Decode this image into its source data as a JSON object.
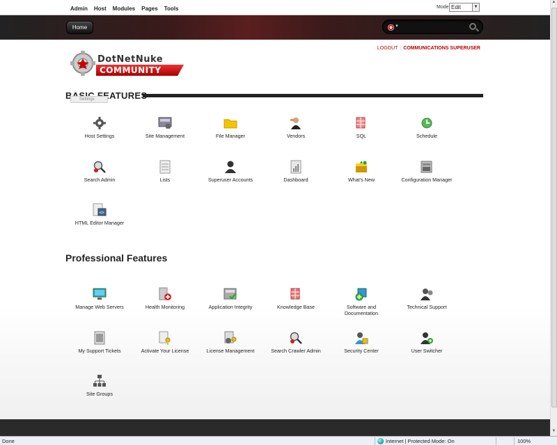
{
  "control_panel": {
    "menu": [
      "Admin",
      "Host",
      "Modules",
      "Pages",
      "Tools"
    ],
    "mode_label": "Mode",
    "mode_value": "Edit"
  },
  "header": {
    "home_label": "Home",
    "search_placeholder": ""
  },
  "user": {
    "logout": "LOGOUT",
    "username": "COMMUNICATIONS SUPERUSER"
  },
  "logo": {
    "top_text": "DotNetNuke",
    "bottom_text": "COMMUNITY"
  },
  "basic": {
    "title": "BASIC FEATURES",
    "tooltip": "Settings",
    "items": [
      {
        "label": "Host Settings",
        "icon": "gear-icon"
      },
      {
        "label": "Site Management",
        "icon": "site-icon"
      },
      {
        "label": "File Manager",
        "icon": "folder-icon"
      },
      {
        "label": "Vendors",
        "icon": "vendor-icon"
      },
      {
        "label": "SQL",
        "icon": "sql-icon"
      },
      {
        "label": "Schedule",
        "icon": "schedule-icon"
      },
      {
        "label": "Search Admin",
        "icon": "search-admin-icon"
      },
      {
        "label": "Lists",
        "icon": "lists-icon"
      },
      {
        "label": "Superuser Accounts",
        "icon": "user-icon"
      },
      {
        "label": "Dashboard",
        "icon": "dashboard-icon"
      },
      {
        "label": "What's New",
        "icon": "whats-new-icon"
      },
      {
        "label": "Configuration Manager",
        "icon": "config-icon"
      },
      {
        "label": "HTML Editor Manager",
        "icon": "html-editor-icon"
      }
    ]
  },
  "professional": {
    "title": "Professional Features",
    "items": [
      {
        "label": "Manage Web Servers",
        "icon": "server-icon"
      },
      {
        "label": "Health Monitoring",
        "icon": "health-icon"
      },
      {
        "label": "Application Integrity",
        "icon": "integrity-icon"
      },
      {
        "label": "Knowledge Base",
        "icon": "knowledge-icon"
      },
      {
        "label": "Software and Documentation",
        "icon": "software-icon"
      },
      {
        "label": "Technical Support",
        "icon": "support-icon"
      },
      {
        "label": "My Support Tickets",
        "icon": "tickets-icon"
      },
      {
        "label": "Activate Your License",
        "icon": "license-icon"
      },
      {
        "label": "License Management",
        "icon": "license-mgmt-icon"
      },
      {
        "label": "Search Crawler Admin",
        "icon": "crawler-icon"
      },
      {
        "label": "Security Center",
        "icon": "security-icon"
      },
      {
        "label": "User Switcher",
        "icon": "user-switcher-icon"
      },
      {
        "label": "Site Groups",
        "icon": "site-groups-icon"
      }
    ]
  },
  "status_bar": {
    "left": "Done",
    "zone": "Internet | Protected Mode: On",
    "zoom": "100%"
  }
}
